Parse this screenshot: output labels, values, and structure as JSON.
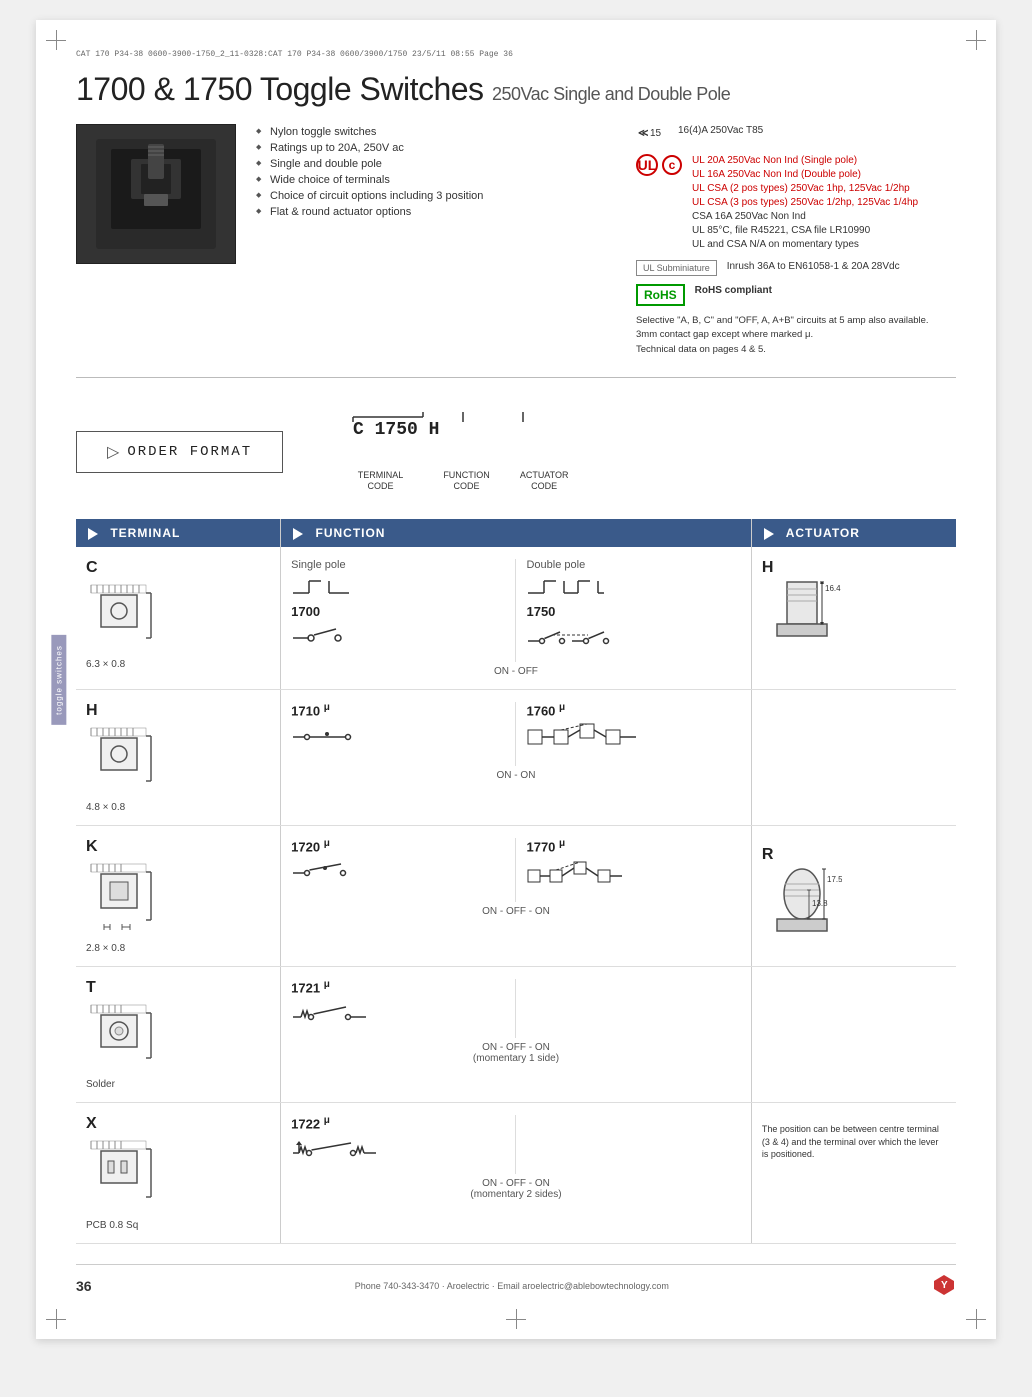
{
  "page": {
    "file_info": "CAT 170 P34-38 0600-3900-1750_2_11-0328:CAT 170 P34-38 0600/3900/1750  23/5/11  08:55  Page 36",
    "title": "1700 & 1750 Toggle Switches",
    "subtitle": "250Vac Single and Double Pole",
    "page_number": "36",
    "footer_phone": "Phone 740-343-3470 · Aroelectric · Email aroelectric@ablebowtechnology.com"
  },
  "features": {
    "items": [
      "Nylon toggle switches",
      "Ratings up to 20A, 250V ac",
      "Single and double pole",
      "Wide choice of terminals",
      "Choice of circuit options including 3 position",
      "Flat & round actuator options"
    ]
  },
  "certifications": {
    "rating": "16(4)A 250Vac T85",
    "ul_items": [
      "UL 20A 250Vac Non Ind (Single pole)",
      "UL 16A 250Vac Non Ind (Double pole)",
      "UL CSA (2 pos types) 250Vac 1hp, 125Vac 1/2hp",
      "UL CSA (3 pos types) 250Vac 1/2hp, 125Vac 1/4hp",
      "CSA 16A 250Vac Non Ind",
      "UL 85°C, file R45221, CSA file LR10990",
      "UL and CSA N/A on momentary types"
    ],
    "imrush": "Inrush 36A to EN61058-1 & 20A 28Vdc",
    "rohs": "RoHS compliant",
    "selective_note": "Selective \"A, B, C\" and \"OFF, A, A+B\" circuits at 5 amp also available.\n3mm contact gap except where marked μ.\nTechnical data on pages 4 & 5."
  },
  "order_format": {
    "label": "ORDER FORMAT",
    "code_example": "C 1750 H",
    "labels": {
      "terminal": "TERMINAL\nCODE",
      "function": "FUNCTION\nCODE",
      "actuator": "ACTUATOR\nCODE"
    }
  },
  "section_headers": {
    "terminal": "TERMINAL",
    "function": "FUNCTION",
    "actuator": "ACTUATOR"
  },
  "terminals": [
    {
      "code": "C",
      "size": "6.3 × 0.8"
    },
    {
      "code": "H",
      "size": "4.8 × 0.8"
    },
    {
      "code": "K",
      "size": "2.8 × 0.8"
    },
    {
      "code": "T",
      "size": "Solder"
    },
    {
      "code": "X",
      "size": "PCB 0.8 Sq"
    }
  ],
  "functions": [
    {
      "single_number": "1700",
      "double_number": "1750",
      "name": "ON - OFF"
    },
    {
      "single_number": "1710 μ",
      "double_number": "1760 μ",
      "name": "ON - ON"
    },
    {
      "single_number": "1720 μ",
      "double_number": "1770 μ",
      "name": "ON - OFF - ON"
    },
    {
      "single_number": "1721 μ",
      "double_number": "",
      "name": "ON - OFF - ON\n(momentary 1 side)"
    },
    {
      "single_number": "1722 μ",
      "double_number": "",
      "name": "ON - OFF - ON\n(momentary 2 sides)"
    }
  ],
  "actuators": [
    {
      "code": "H",
      "dim1": "16.4"
    },
    {
      "code": "R",
      "dim1": "17.5",
      "dim2": "13.8"
    }
  ],
  "actuator_note": "The position can be between centre terminal (3 & 4) and the terminal over which the lever is positioned.",
  "side_tab": "toggle switches"
}
